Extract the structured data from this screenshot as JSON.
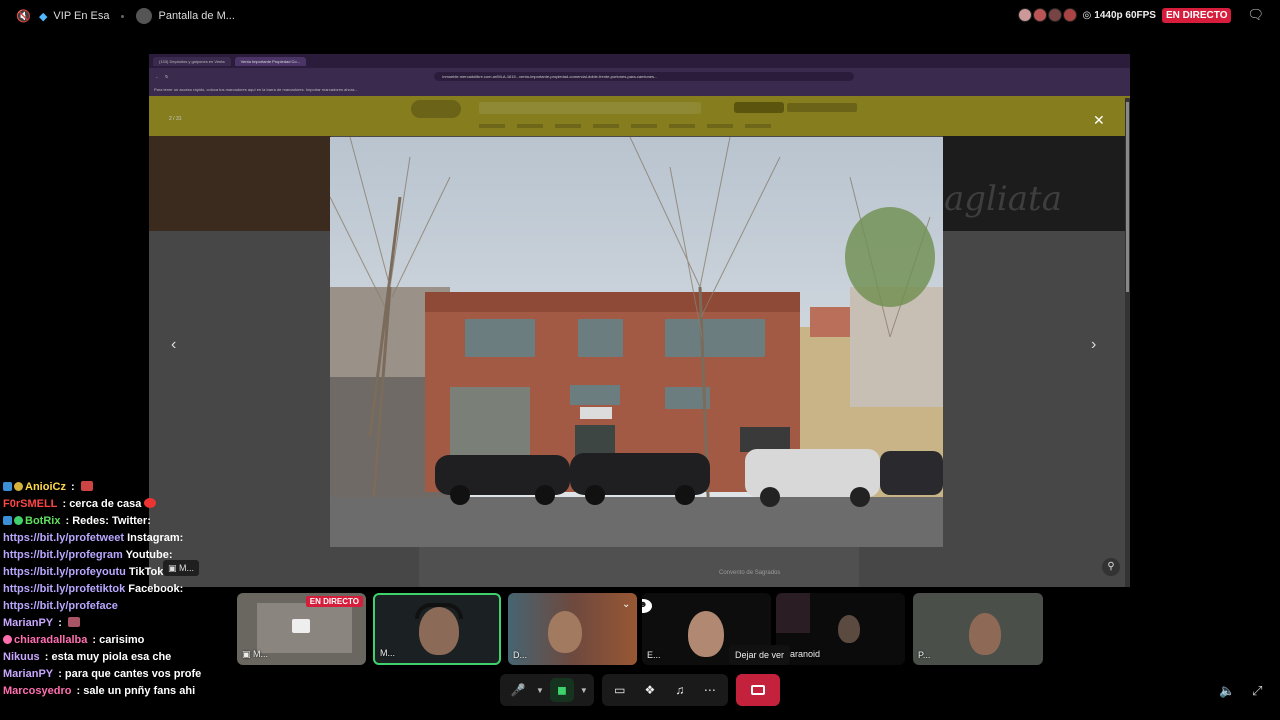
{
  "topbar": {
    "server_name": "VIP En Esa",
    "stream_title": "Pantalla de M...",
    "quality": "1440p 60FPS",
    "live_label": "EN DIRECTO"
  },
  "browser": {
    "tabs": [
      "(133) Depósitos y galpones en Venta",
      "Venta Importante Propiedad Co..."
    ],
    "url": "inmueble.mercadolibre.com.ar/MLA-1615...venta-importante-propiedad-comercial-doble-frente-portones-para-camiones...",
    "bookmarks_text": "Para tener un acceso rápido, coloca tus marcadores aquí en la barra de marcadores. Importar marcadores ahora..."
  },
  "viewer": {
    "counter": "2 / 31",
    "watermark": "agliata",
    "map_label": "Convento de Sagrados"
  },
  "chat": [
    {
      "user": "AnioiCz",
      "text": "",
      "color": "#ffd84a"
    },
    {
      "user": "F0rSMELL",
      "text": "cerca de casa",
      "color": "#ff4646"
    },
    {
      "user": "BotRix",
      "text": "Redes: Twitter:",
      "color": "#5ee05e"
    },
    {
      "link": "https://bit.ly/profetweet",
      "text": "Instagram:"
    },
    {
      "link": "https://bit.ly/profegram",
      "text": "Youtube:"
    },
    {
      "link": "https://bit.ly/profeyoutu",
      "text": "TikTok:"
    },
    {
      "link": "https://bit.ly/profetiktok",
      "text": "Facebook:"
    },
    {
      "link": "https://bit.ly/profeface",
      "text": ""
    },
    {
      "user": "MarianPY",
      "text": "",
      "color": "#c8a7ff"
    },
    {
      "user": "chiaradallalba",
      "text": "carisimo",
      "color": "#ff6fb0"
    },
    {
      "user": "Nikuus",
      "text": "esta muy piola esa che",
      "color": "#c8a7ff"
    },
    {
      "user": "MarianPY",
      "text": "para que cantes vos profe",
      "color": "#c8a7ff"
    },
    {
      "user": "Marcosyedro",
      "text": "sale un pnñy fans ahi",
      "color": "#ff6fb0"
    }
  ],
  "chat_chip": "M...",
  "participants": [
    {
      "label": "M...",
      "live": "EN DIRECTO"
    },
    {
      "label": "M..."
    },
    {
      "label": "D..."
    },
    {
      "label": "E..."
    },
    {
      "label": "aranoid"
    },
    {
      "label": "P..."
    }
  ],
  "controls": {
    "tooltip": "Dejar de ver"
  },
  "colors": {
    "live": "#d61e3c",
    "stop": "#c4213c",
    "camera_on": "#3fd16b",
    "link": "#b9a7ff"
  },
  "icons": [
    "speaker-muted-icon",
    "gem-icon",
    "quality-icon",
    "chat-bubble-icon",
    "microphone-icon",
    "camera-icon",
    "screen-share-icon",
    "activities-icon",
    "soundboard-icon",
    "more-icon",
    "stop-watching-icon",
    "volume-icon",
    "minimize-icon",
    "zoom-icon",
    "close-icon"
  ]
}
